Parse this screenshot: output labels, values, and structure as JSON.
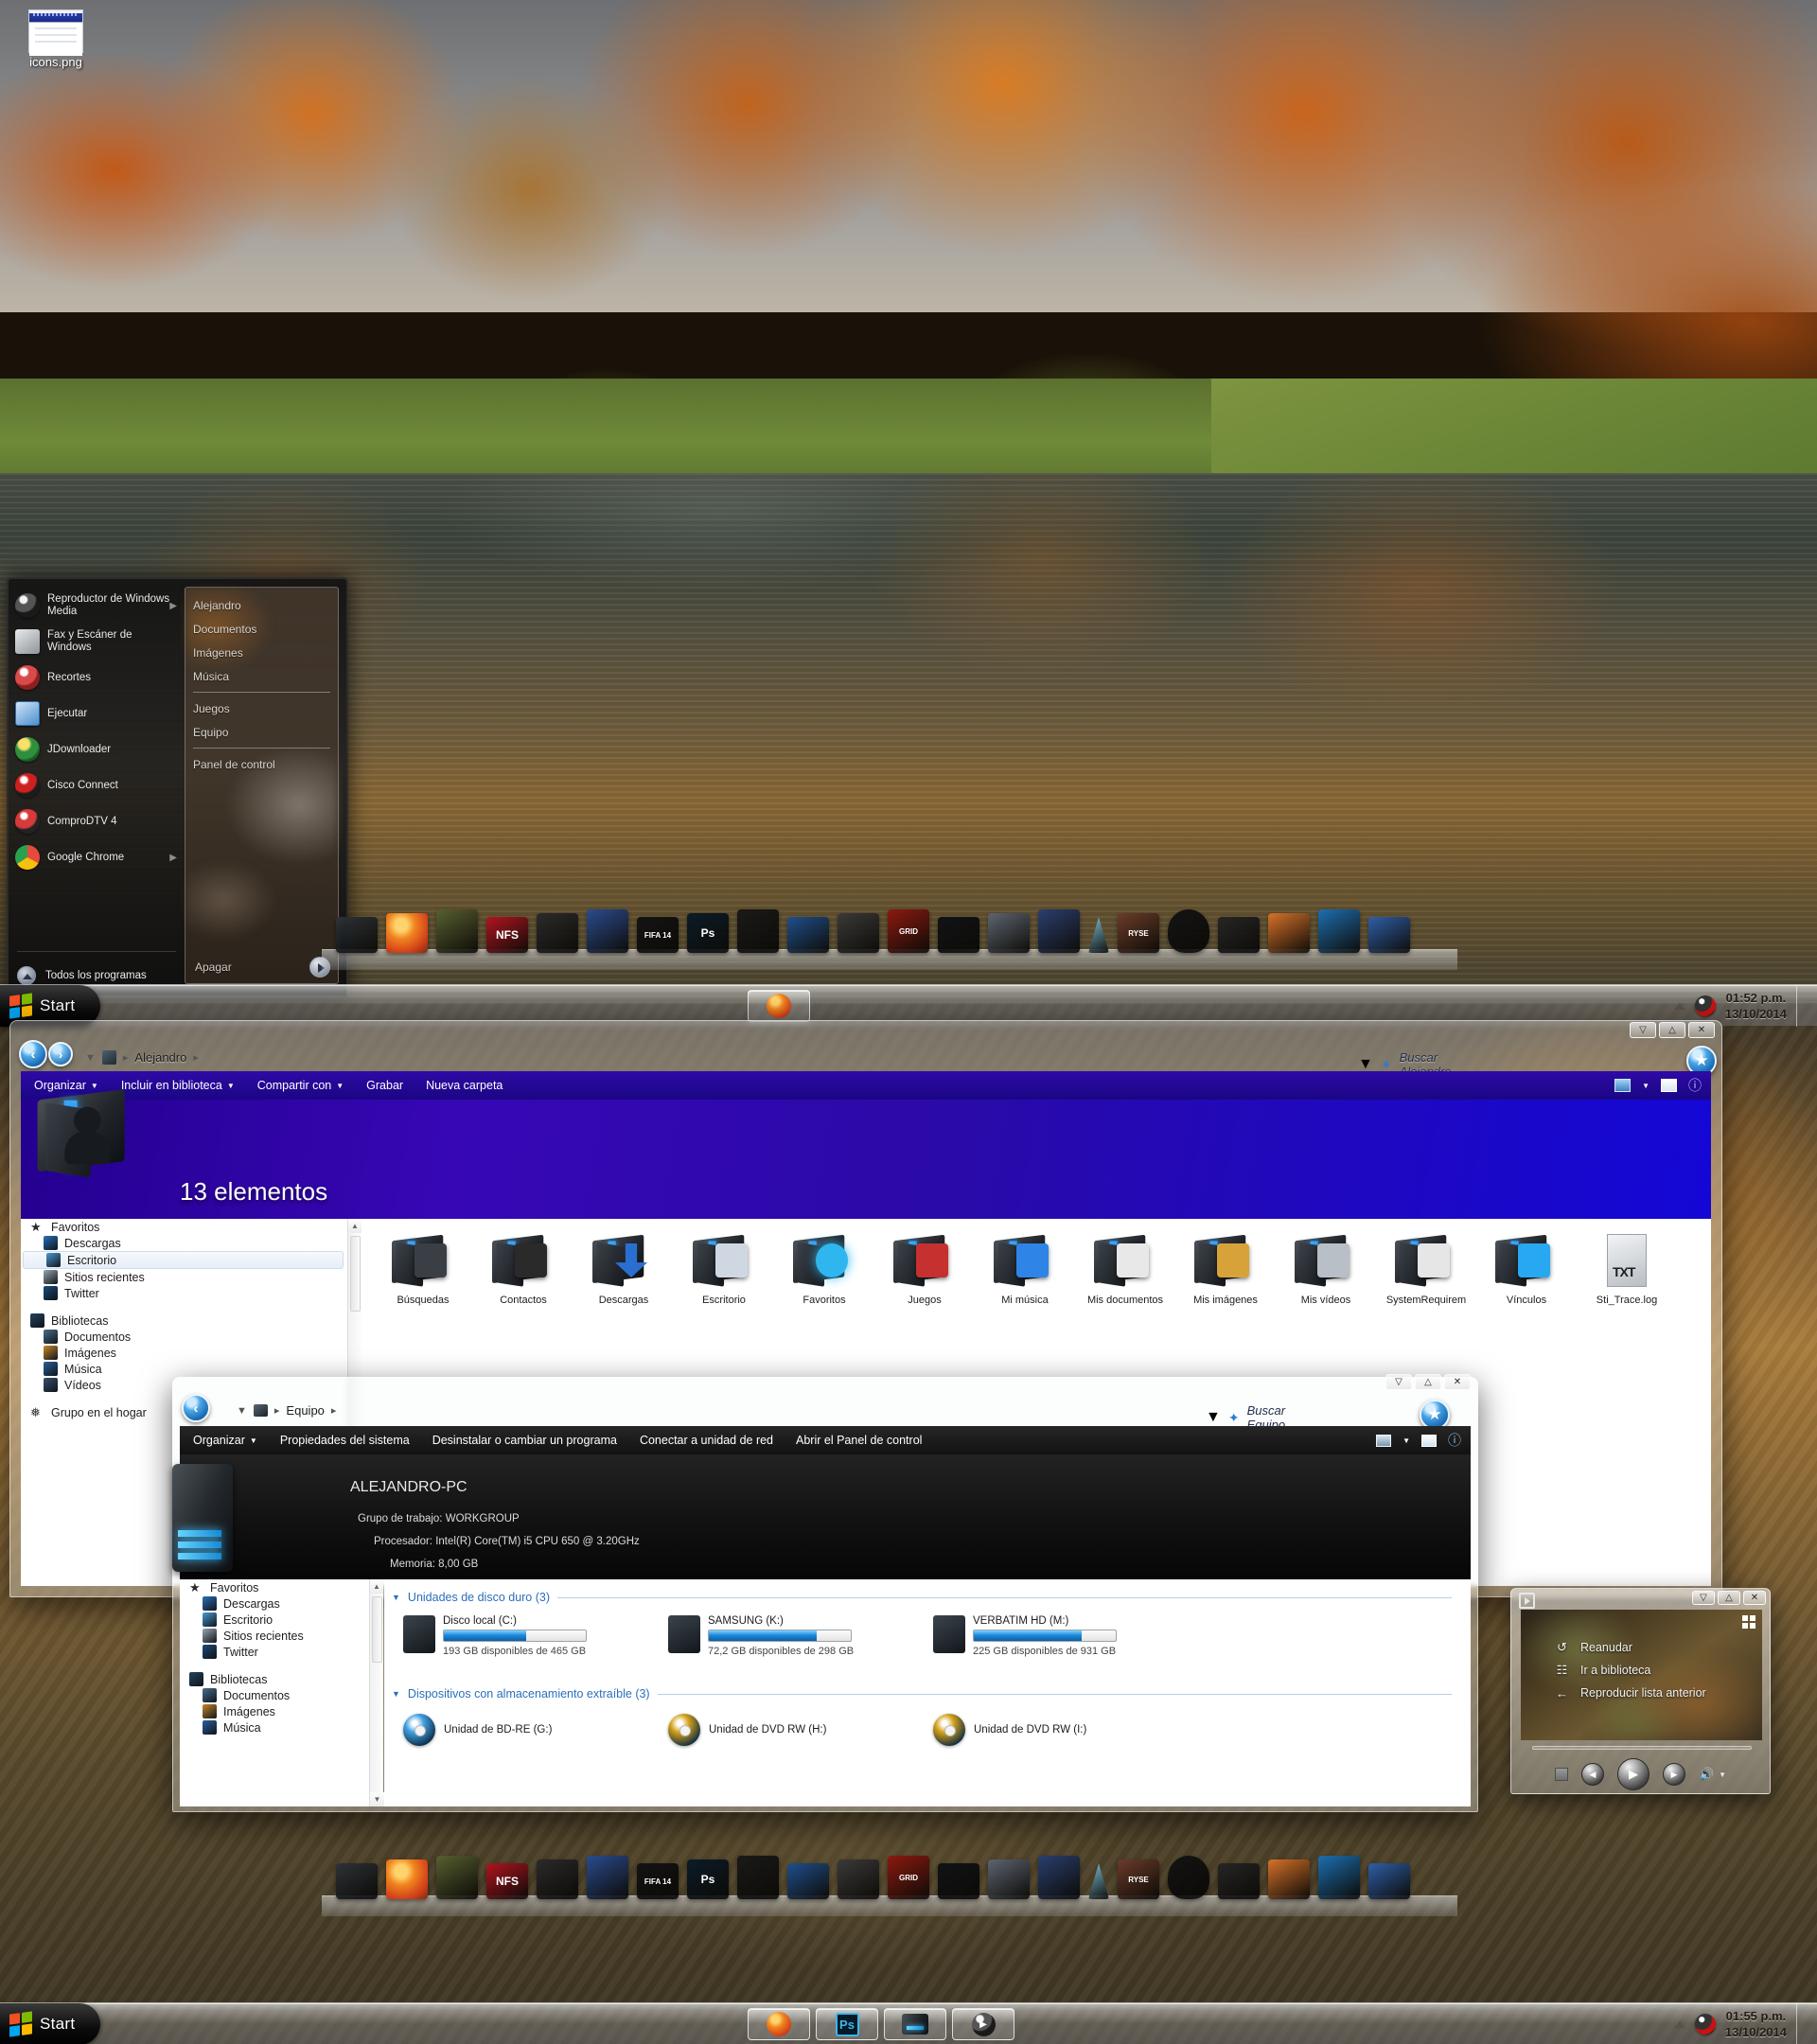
{
  "desktop": {
    "icon_label": "icons.png",
    "icon_name": "image-file-icon"
  },
  "start_menu": {
    "left_items": [
      {
        "label": "Reproductor de Windows Media",
        "icon": "media-player-icon",
        "has_submenu": true
      },
      {
        "label": "Fax y Escáner de Windows",
        "icon": "fax-scanner-icon",
        "has_submenu": false
      },
      {
        "label": "Recortes",
        "icon": "snipping-tool-icon",
        "has_submenu": false
      },
      {
        "label": "Ejecutar",
        "icon": "run-dialog-icon",
        "has_submenu": false
      },
      {
        "label": "JDownloader",
        "icon": "jdownloader-icon",
        "has_submenu": false
      },
      {
        "label": "Cisco Connect",
        "icon": "cisco-connect-icon",
        "has_submenu": false
      },
      {
        "label": "ComproDTV 4",
        "icon": "comprodtv-icon",
        "has_submenu": false
      },
      {
        "label": "Google Chrome",
        "icon": "chrome-icon",
        "has_submenu": true
      }
    ],
    "all_programs": "Todos los programas",
    "right_items": [
      {
        "label": "Alejandro"
      },
      {
        "label": "Documentos"
      },
      {
        "label": "Imágenes"
      },
      {
        "label": "Música"
      },
      {
        "label": "Juegos"
      },
      {
        "label": "Equipo"
      },
      {
        "label": "Panel de control"
      }
    ],
    "shutdown": "Apagar"
  },
  "taskbar_top": {
    "start_label": "Start",
    "buttons": [
      {
        "name": "firefox-taskbar-button",
        "icon": "firefox-icon"
      }
    ],
    "clock": {
      "time": "01:52 p.m.",
      "date": "13/10/2014"
    }
  },
  "taskbar_bottom": {
    "start_label": "Start",
    "buttons": [
      {
        "name": "firefox-taskbar-button",
        "icon": "firefox-icon"
      },
      {
        "name": "photoshop-taskbar-button",
        "icon": "photoshop-icon",
        "label": "Ps"
      },
      {
        "name": "computer-taskbar-button",
        "icon": "computer-tower-icon"
      },
      {
        "name": "media-player-taskbar-button",
        "icon": "media-player-icon"
      }
    ],
    "clock": {
      "time": "01:55 p.m.",
      "date": "13/10/2014"
    }
  },
  "dock": {
    "items": [
      {
        "name": "computer-tower-dock-icon",
        "color": "#2e3338"
      },
      {
        "name": "firefox-dock-icon",
        "color": "#e8681c"
      },
      {
        "name": "camcorder-dock-icon",
        "color": "#586030"
      },
      {
        "name": "need-for-speed-dock-icon",
        "color": "#b01520",
        "label": "NFS"
      },
      {
        "name": "printer-dock-icon",
        "color": "#2b2b2b"
      },
      {
        "name": "book-dock-icon",
        "color": "#2a4c8f"
      },
      {
        "name": "fifa14-dock-icon",
        "color": "#141414",
        "label": "FIFA 14"
      },
      {
        "name": "photoshop-dock-icon",
        "color": "#0b1c28",
        "label": "Ps"
      },
      {
        "name": "winamp-dock-icon",
        "color": "#1a1a1a"
      },
      {
        "name": "music-folder-dock-icon",
        "color": "#1f4f8c"
      },
      {
        "name": "shadow-of-mordor-dock-icon",
        "color": "#3a3a3a"
      },
      {
        "name": "grid-dock-icon",
        "color": "#8c1a10",
        "label": "GRID"
      },
      {
        "name": "notebook-dock-icon",
        "color": "#111317"
      },
      {
        "name": "wallet-dock-icon",
        "color": "#5d6570"
      },
      {
        "name": "gallery-folder-dock-icon",
        "color": "#2a3f6e"
      },
      {
        "name": "cone-dock-icon",
        "color": "#7bc0d8"
      },
      {
        "name": "ryse-dock-icon",
        "color": "#6b3c2a",
        "label": "RYSE"
      },
      {
        "name": "balloon-dock-icon",
        "color": "#141414"
      },
      {
        "name": "camera-dock-icon",
        "color": "#262626"
      },
      {
        "name": "candle-dock-icon",
        "color": "#d6722a"
      },
      {
        "name": "blue-orb-dock-icon",
        "color": "#1d6fb0"
      },
      {
        "name": "blue-panel-dock-icon",
        "color": "#2f5fa8"
      }
    ]
  },
  "window_alejandro": {
    "title_path": "Alejandro",
    "path_icon": "user-folder-icon",
    "search_placeholder": "Buscar Alejandro",
    "window_buttons": {
      "minimize": "▽",
      "maximize": "△",
      "close": "✕"
    },
    "toolbar": [
      {
        "label": "Organizar",
        "caret": true
      },
      {
        "label": "Incluir en biblioteca",
        "caret": true
      },
      {
        "label": "Compartir con",
        "caret": true
      },
      {
        "label": "Grabar",
        "caret": false
      },
      {
        "label": "Nueva carpeta",
        "caret": false
      }
    ],
    "banner": {
      "item_count": "13 elementos",
      "icon": "user-folder-large-icon"
    },
    "nav_tree": [
      {
        "label": "Favoritos",
        "level": 0,
        "icon": "favorites-star-icon"
      },
      {
        "label": "Descargas",
        "level": 1,
        "icon": "downloads-icon"
      },
      {
        "label": "Escritorio",
        "level": 1,
        "icon": "desktop-icon",
        "selected": true
      },
      {
        "label": "Sitios recientes",
        "level": 1,
        "icon": "recent-places-icon"
      },
      {
        "label": "Twitter",
        "level": 1,
        "icon": "twitter-icon"
      },
      {
        "label": "",
        "level": 0,
        "icon": "spacer"
      },
      {
        "label": "Bibliotecas",
        "level": 0,
        "icon": "libraries-icon"
      },
      {
        "label": "Documentos",
        "level": 1,
        "icon": "documents-icon"
      },
      {
        "label": "Imágenes",
        "level": 1,
        "icon": "pictures-icon"
      },
      {
        "label": "Música",
        "level": 1,
        "icon": "music-icon"
      },
      {
        "label": "Vídeos",
        "level": 1,
        "icon": "videos-icon"
      },
      {
        "label": "",
        "level": 0,
        "icon": "spacer"
      },
      {
        "label": "Grupo en el hogar",
        "level": 0,
        "icon": "homegroup-icon"
      }
    ],
    "items": [
      {
        "label": "Búsquedas",
        "icon": "searches-folder-icon"
      },
      {
        "label": "Contactos",
        "icon": "contacts-folder-icon"
      },
      {
        "label": "Descargas",
        "icon": "downloads-folder-icon"
      },
      {
        "label": "Escritorio",
        "icon": "desktop-folder-icon"
      },
      {
        "label": "Favoritos",
        "icon": "favorites-folder-icon"
      },
      {
        "label": "Juegos",
        "icon": "games-folder-icon"
      },
      {
        "label": "Mi música",
        "icon": "music-folder-icon"
      },
      {
        "label": "Mis documentos",
        "icon": "documents-folder-icon"
      },
      {
        "label": "Mis imágenes",
        "icon": "pictures-folder-icon"
      },
      {
        "label": "Mis vídeos",
        "icon": "videos-folder-icon"
      },
      {
        "label": "SystemRequirem",
        "icon": "generic-folder-icon"
      },
      {
        "label": "Vínculos",
        "icon": "links-folder-icon"
      },
      {
        "label": "Sti_Trace.log",
        "icon": "text-file-icon",
        "badge": "TXT"
      }
    ]
  },
  "window_equipo": {
    "title_path": "Equipo",
    "path_icon": "computer-icon",
    "search_placeholder": "Buscar Equipo",
    "window_buttons": {
      "minimize": "▽",
      "maximize": "△",
      "close": "✕"
    },
    "toolbar": [
      {
        "label": "Organizar",
        "caret": true
      },
      {
        "label": "Propiedades del sistema",
        "caret": false
      },
      {
        "label": "Desinstalar o cambiar un programa",
        "caret": false
      },
      {
        "label": "Conectar a unidad de red",
        "caret": false
      },
      {
        "label": "Abrir el Panel de control",
        "caret": false
      }
    ],
    "system_info": {
      "pc_name": "ALEJANDRO-PC",
      "workgroup_label": "Grupo de trabajo:",
      "workgroup_value": "WORKGROUP",
      "processor_label": "Procesador:",
      "processor_value": "Intel(R) Core(TM) i5 CPU       650  @ 3.20GHz",
      "memory_label": "Memoria:",
      "memory_value": "8,00 GB"
    },
    "nav_tree": [
      {
        "label": "Favoritos",
        "level": 0,
        "icon": "favorites-star-icon"
      },
      {
        "label": "Descargas",
        "level": 1,
        "icon": "downloads-icon"
      },
      {
        "label": "Escritorio",
        "level": 1,
        "icon": "desktop-icon"
      },
      {
        "label": "Sitios recientes",
        "level": 1,
        "icon": "recent-places-icon"
      },
      {
        "label": "Twitter",
        "level": 1,
        "icon": "twitter-icon"
      },
      {
        "label": "",
        "level": 0,
        "icon": "spacer"
      },
      {
        "label": "Bibliotecas",
        "level": 0,
        "icon": "libraries-icon"
      },
      {
        "label": "Documentos",
        "level": 1,
        "icon": "documents-icon"
      },
      {
        "label": "Imágenes",
        "level": 1,
        "icon": "pictures-icon"
      },
      {
        "label": "Música",
        "level": 1,
        "icon": "music-icon"
      }
    ],
    "sections": [
      {
        "title": "Unidades de disco duro (3)"
      },
      {
        "title": "Dispositivos con almacenamiento extraíble (3)"
      }
    ],
    "drives": [
      {
        "name": "Disco local (C:)",
        "free_text": "193 GB disponibles de 465 GB",
        "used_pct": 58,
        "icon": "windows-drive-icon"
      },
      {
        "name": "SAMSUNG (K:)",
        "free_text": "72,2 GB disponibles de 298 GB",
        "used_pct": 76,
        "icon": "hard-drive-icon"
      },
      {
        "name": "VERBATIM HD (M:)",
        "free_text": "225 GB disponibles de 931 GB",
        "used_pct": 76,
        "icon": "hard-drive-icon"
      }
    ],
    "optical": [
      {
        "name": "Unidad de BD-RE (G:)",
        "icon": "bluray-drive-icon",
        "color": "#3f9fe0"
      },
      {
        "name": "Unidad de DVD RW (H:)",
        "icon": "dvd-drive-icon",
        "color": "#d4a017"
      },
      {
        "name": "Unidad de DVD RW (I:)",
        "icon": "dvd-drive-icon",
        "color": "#d4a017"
      }
    ]
  },
  "media_player": {
    "window_buttons": {
      "minimize": "▽",
      "maximize": "△",
      "close": "✕"
    },
    "logo_name": "media-player-logo-icon",
    "menu": [
      {
        "label": "Reanudar",
        "icon": "resume-circle-icon"
      },
      {
        "label": "Ir a biblioteca",
        "icon": "library-icon"
      },
      {
        "label": "Reproducir lista anterior",
        "icon": "back-arrow-icon"
      }
    ],
    "controls": [
      {
        "name": "stop-button",
        "glyph": ""
      },
      {
        "name": "previous-button",
        "glyph": "◀"
      },
      {
        "name": "play-button",
        "glyph": "▶"
      },
      {
        "name": "next-button",
        "glyph": "▶"
      },
      {
        "name": "volume-button",
        "glyph": "🔊"
      }
    ]
  },
  "colors": {
    "banner_blue": "#2409a0",
    "link_blue": "#2a6fbb",
    "drive_bar": "#1f8ada",
    "dark_panel": "#101010"
  }
}
